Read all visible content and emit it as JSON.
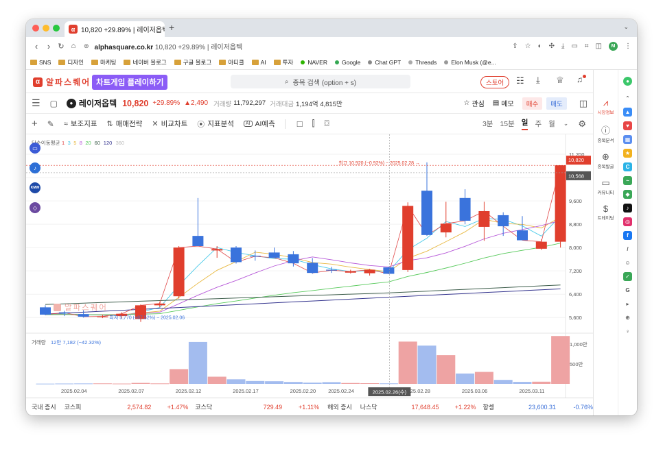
{
  "browser": {
    "tab_title": "10,820 +29.89% | 레이저옵텍",
    "favicon": "α",
    "new_tab": "+",
    "url_host": "alphasquare.co.kr",
    "url_rest": "10,820 +29.89% | 레이저옵텍",
    "profile": "M"
  },
  "bookmarks": [
    {
      "label": "SNS",
      "kind": "folder"
    },
    {
      "label": "디자인",
      "kind": "folder"
    },
    {
      "label": "마케팅",
      "kind": "folder"
    },
    {
      "label": "네이버 블로그",
      "kind": "folder"
    },
    {
      "label": "구글 블로그",
      "kind": "folder"
    },
    {
      "label": "아티클",
      "kind": "folder"
    },
    {
      "label": "AI",
      "kind": "folder"
    },
    {
      "label": "투자",
      "kind": "folder"
    },
    {
      "label": "NAVER",
      "kind": "dot",
      "color": "#2db400"
    },
    {
      "label": "Google",
      "kind": "dot",
      "color": "#34a853"
    },
    {
      "label": "Chat GPT",
      "kind": "dot",
      "color": "#888888"
    },
    {
      "label": "Threads",
      "kind": "dot",
      "color": "#aaaaaa"
    },
    {
      "label": "Elon Musk (@e...",
      "kind": "dot",
      "color": "#999999"
    }
  ],
  "header": {
    "logo_text": "알파스퀘어",
    "promo": "차트게임 플레이하기",
    "search_placeholder": "종목 검색 (option + s)",
    "store": "스토어"
  },
  "stock": {
    "name": "레이저옵텍",
    "price": "10,820",
    "change_pct": "+29.89%",
    "change_abs": "▲2,490",
    "volume_label": "거래량",
    "volume": "11,792,297",
    "amount_label": "거래대금",
    "amount": "1,194억 4,815만",
    "watch": "관심",
    "memo": "메모",
    "buy": "매수",
    "sell": "매도"
  },
  "toolbar2": {
    "aux": "보조지표",
    "strategy": "매매전략",
    "compare": "비교차트",
    "analysis": "지표분석",
    "ai": "AI예측",
    "intervals": [
      "3분",
      "15분",
      "일",
      "주",
      "월"
    ],
    "active_interval": "일"
  },
  "sidebar": [
    {
      "label": "시장정보",
      "icon": "chart-icon"
    },
    {
      "label": "종목분석",
      "icon": "info-icon"
    },
    {
      "label": "종목발굴",
      "icon": "magnify-icon"
    },
    {
      "label": "커뮤니티",
      "icon": "chat-icon"
    },
    {
      "label": "트레이딩",
      "icon": "trade-icon"
    }
  ],
  "chart_data": {
    "type": "candlestick",
    "ma_label": "단순이동평균",
    "ma_periods": [
      "1",
      "3",
      "5",
      "8",
      "20",
      "60",
      "120",
      "360"
    ],
    "ma_colors": [
      "#e04545",
      "#46c9e8",
      "#e8b83f",
      "#b657d8",
      "#56c95a",
      "#3d5d4b",
      "#34348e",
      "#bbbbbb"
    ],
    "y_ticks": [
      11200,
      10400,
      9600,
      8800,
      8000,
      7200,
      6400,
      5600
    ],
    "ylim": [
      5300,
      11600
    ],
    "candles": [
      {
        "o": 5950,
        "h": 6020,
        "l": 5680,
        "c": 5700
      },
      {
        "o": 5780,
        "h": 5830,
        "l": 5650,
        "c": 5770
      },
      {
        "o": 5720,
        "h": 5850,
        "l": 5600,
        "c": 5630
      },
      {
        "o": 5630,
        "h": 5700,
        "l": 5580,
        "c": 5640
      },
      {
        "o": 5650,
        "h": 5780,
        "l": 5560,
        "c": 5730
      },
      {
        "o": 5550,
        "h": 6050,
        "l": 5450,
        "c": 6020
      },
      {
        "o": 6020,
        "h": 6150,
        "l": 5950,
        "c": 6080
      },
      {
        "o": 6330,
        "h": 8050,
        "l": 6250,
        "c": 8000
      },
      {
        "o": 8400,
        "h": 9700,
        "l": 8150,
        "c": 8050
      },
      {
        "o": 7900,
        "h": 8050,
        "l": 7650,
        "c": 7950
      },
      {
        "o": 8000,
        "h": 8050,
        "l": 7450,
        "c": 7500
      },
      {
        "o": 7720,
        "h": 7900,
        "l": 7550,
        "c": 7700
      },
      {
        "o": 7830,
        "h": 8000,
        "l": 7650,
        "c": 7650
      },
      {
        "o": 7770,
        "h": 7880,
        "l": 7350,
        "c": 7460
      },
      {
        "o": 7480,
        "h": 7640,
        "l": 7100,
        "c": 7130
      },
      {
        "o": 7240,
        "h": 7340,
        "l": 7130,
        "c": 7220
      },
      {
        "o": 7140,
        "h": 7240,
        "l": 7110,
        "c": 7180
      },
      {
        "o": 7120,
        "h": 7270,
        "l": 7040,
        "c": 7240
      },
      {
        "o": 7320,
        "h": 7340,
        "l": 7100,
        "c": 7100
      },
      {
        "o": 7230,
        "h": 9550,
        "l": 7160,
        "c": 9430
      },
      {
        "o": 9950,
        "h": 10920,
        "l": 8400,
        "c": 8430
      },
      {
        "o": 8520,
        "h": 9570,
        "l": 8350,
        "c": 8820
      },
      {
        "o": 9700,
        "h": 10000,
        "l": 8800,
        "c": 8920
      },
      {
        "o": 8710,
        "h": 9570,
        "l": 8230,
        "c": 9250
      },
      {
        "o": 9110,
        "h": 9210,
        "l": 8400,
        "c": 8730
      },
      {
        "o": 8590,
        "h": 9080,
        "l": 8290,
        "c": 8250
      },
      {
        "o": 7960,
        "h": 8280,
        "l": 7920,
        "c": 8200
      },
      {
        "o": 8200,
        "h": 10820,
        "l": 8000,
        "c": 10820
      }
    ],
    "x_labels": [
      "2025.02.04",
      "2025.02.07",
      "2025.02.12",
      "2025.02.17",
      "2025.02.20",
      "2025.02.24",
      "2025.02.28",
      "2025.03.06",
      "2025.03.11"
    ],
    "high_annotation": "최고 10,920 (−0.92%) − 2025.02.28 →",
    "low_annotation": "최저 5,770 (+87.52%) − 2025.02.06",
    "price_tag": "10,820",
    "price_tag2": "10,568",
    "crosshair_date": "2025.02.26(수)",
    "volume_label": "거래량",
    "volume_info": "12만 7,182 (−42.32%)",
    "volume_ticks": [
      "1,000만",
      "500만"
    ],
    "volume_ylim": [
      0,
      11000000
    ],
    "volumes": [
      60000,
      90000,
      110000,
      130000,
      80000,
      240000,
      120000,
      3700000,
      10500000,
      1800000,
      1150000,
      720000,
      660000,
      480000,
      310000,
      430000,
      220000,
      170000,
      130000,
      10600000,
      9600000,
      7200000,
      2600000,
      3000000,
      1000000,
      500000,
      550000,
      12000000
    ],
    "watermark": "알파스퀘어"
  },
  "ticker": [
    {
      "market": "국내 증시",
      "items": [
        {
          "name": "코스피",
          "value": "2,574.82",
          "change": "+1.47%"
        },
        {
          "name": "코스닥",
          "value": "729.49",
          "change": "+1.11%"
        }
      ]
    },
    {
      "market": "해외 증시",
      "items": [
        {
          "name": "나스닥",
          "value": "17,648.45",
          "change": "+1.22%"
        },
        {
          "name": "항셍",
          "value": "23,600.31",
          "change": "-0.76%"
        }
      ]
    }
  ]
}
